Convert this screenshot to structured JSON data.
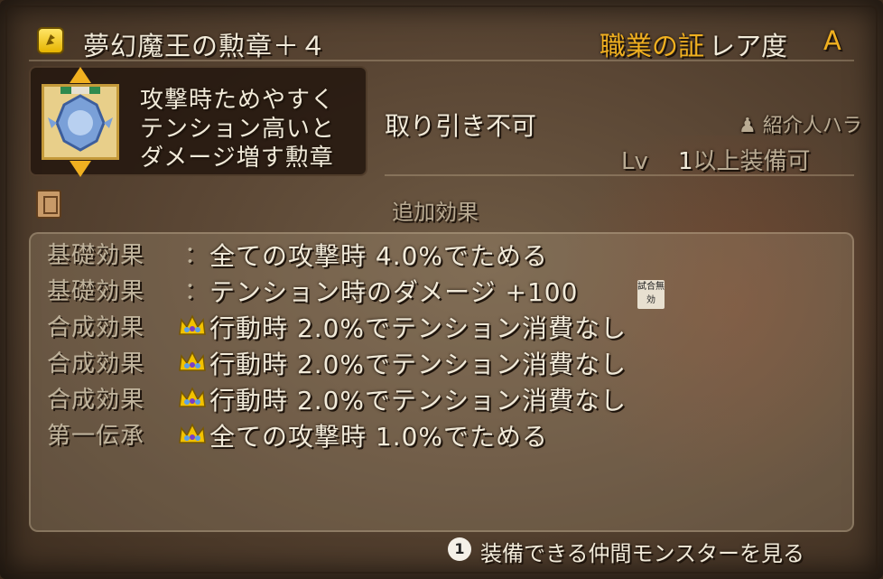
{
  "item": {
    "name": "夢幻魔王の勲章＋４",
    "category": "職業の証",
    "rarity_label": "レア度",
    "rarity": "A",
    "icon": "medal-icon",
    "description": [
      "攻撃時ためやすく",
      "テンション高いと",
      "ダメージ増す勲章"
    ],
    "trade_status": "取り引き不可",
    "introducer": "紹介人ハラ",
    "level_prefix": "Lv",
    "level_value": "1",
    "level_suffix": "以上装備可"
  },
  "effects": {
    "header": "追加効果",
    "rows": [
      {
        "label": "基礎効果",
        "sep": "：",
        "crown": false,
        "text": "全ての攻撃時 4.0%でためる"
      },
      {
        "label": "基礎効果",
        "sep": "：",
        "crown": false,
        "text": "テンション時のダメージ +100"
      },
      {
        "label": "合成効果",
        "sep": "",
        "crown": true,
        "text": "行動時 2.0%でテンション消費なし"
      },
      {
        "label": "合成効果",
        "sep": "",
        "crown": true,
        "text": "行動時 2.0%でテンション消費なし"
      },
      {
        "label": "合成効果",
        "sep": "",
        "crown": true,
        "text": "行動時 2.0%でテンション消費なし"
      },
      {
        "label": "第一伝承",
        "sep": "",
        "crown": true,
        "text": "全ての攻撃時 1.0%でためる"
      }
    ],
    "badge_text": "試合無効"
  },
  "footer": {
    "button_number": "1",
    "action_label": "装備できる仲間モンスターを見る"
  },
  "colors": {
    "accent_gold": "#f0b020",
    "text": "#f1ead9",
    "label_text": "#bfb39c"
  }
}
